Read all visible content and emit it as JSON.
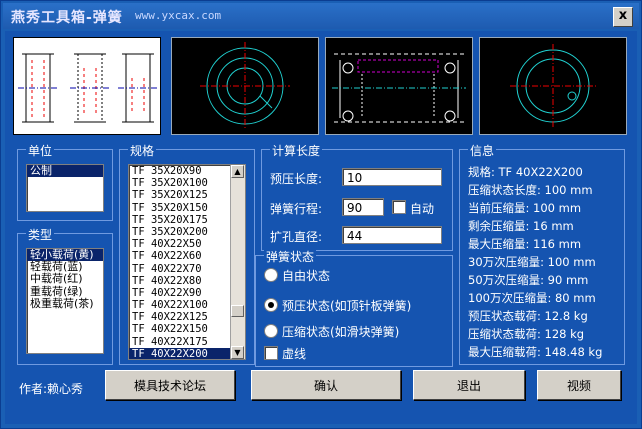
{
  "window": {
    "title": "燕秀工具箱-弹簧",
    "url": "www.yxcax.com",
    "close": "x"
  },
  "unit": {
    "label": "单位",
    "items": [
      "公制"
    ],
    "selected": 0
  },
  "type": {
    "label": "类型",
    "items": [
      "轻小载荷(黄)",
      "轻载荷(蓝)",
      "中载荷(红)",
      "重载荷(绿)",
      "极重载荷(茶)"
    ],
    "selected": 0
  },
  "spec": {
    "label": "规格",
    "items": [
      "TF 35X20X90",
      "TF 35X20X100",
      "TF 35X20X125",
      "TF 35X20X150",
      "TF 35X20X175",
      "TF 35X20X200",
      "TF 40X22X50",
      "TF 40X22X60",
      "TF 40X22X70",
      "TF 40X22X80",
      "TF 40X22X90",
      "TF 40X22X100",
      "TF 40X22X125",
      "TF 40X22X150",
      "TF 40X22X175",
      "TF 40X22X200"
    ],
    "selected": 15
  },
  "calc": {
    "label": "计算长度",
    "preload_label": "预压长度:",
    "preload_value": "10",
    "stroke_label": "弹簧行程:",
    "stroke_value": "90",
    "auto_label": "自动",
    "bore_label": "扩孔直径:",
    "bore_value": "44"
  },
  "state": {
    "label": "弹簧状态",
    "options": [
      "自由状态",
      "预压状态(如顶针板弹簧)",
      "压缩状态(如滑块弹簧)"
    ],
    "selected": 1,
    "dashed_label": "虚线"
  },
  "info": {
    "label": "信息",
    "lines": [
      "规格: TF 40X22X200",
      "压缩状态长度:   100 mm",
      "当前压缩量:     100 mm",
      "剩余压缩量:     16 mm",
      "最大压缩量:     116 mm",
      "30万次压缩量:   100 mm",
      "50万次压缩量:   90 mm",
      "100万次压缩量:  80 mm",
      "预压状态载荷:   12.8 kg",
      "压缩状态载荷:   128 kg",
      "最大压缩载荷:   148.48 kg"
    ]
  },
  "footer": {
    "author": "作者:赖心秀",
    "forum_button": "模具技术论坛",
    "ok_button": "确认",
    "exit_button": "退出",
    "video_button": "视频"
  },
  "colors": {
    "background": "#1554b0",
    "selection": "#0a246a"
  }
}
